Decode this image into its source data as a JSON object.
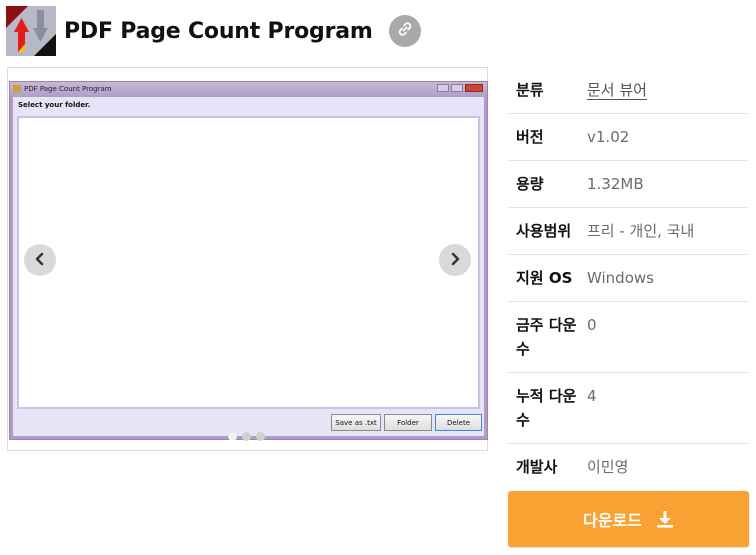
{
  "header": {
    "title": "PDF Page Count Program",
    "logo_icon": "pdf-arrows-logo-icon",
    "link_icon": "link-icon"
  },
  "carousel": {
    "window_title": "PDF Page Count Program",
    "folder_label": "Select your folder.",
    "buttons": {
      "save": "Save as .txt",
      "folder": "Folder",
      "delete": "Delete"
    },
    "prev_icon": "chevron-left-icon",
    "next_icon": "chevron-right-icon",
    "slide_count": 3,
    "active_slide": 1
  },
  "info": {
    "rows": [
      {
        "key": "분류",
        "value": "문서 뷰어"
      },
      {
        "key": "버전",
        "value": "v1.02"
      },
      {
        "key": "용량",
        "value": "1.32MB"
      },
      {
        "key": "사용범위",
        "value": "프리 - 개인, 국내"
      },
      {
        "key": "지원 OS",
        "value": "Windows"
      },
      {
        "key": "금주 다운수",
        "value": "0"
      },
      {
        "key": "누적 다운수",
        "value": "4"
      },
      {
        "key": "개발사",
        "value": "이민영"
      }
    ]
  },
  "download": {
    "label": "다운로드",
    "icon": "download-icon",
    "color": "#f7a232"
  }
}
